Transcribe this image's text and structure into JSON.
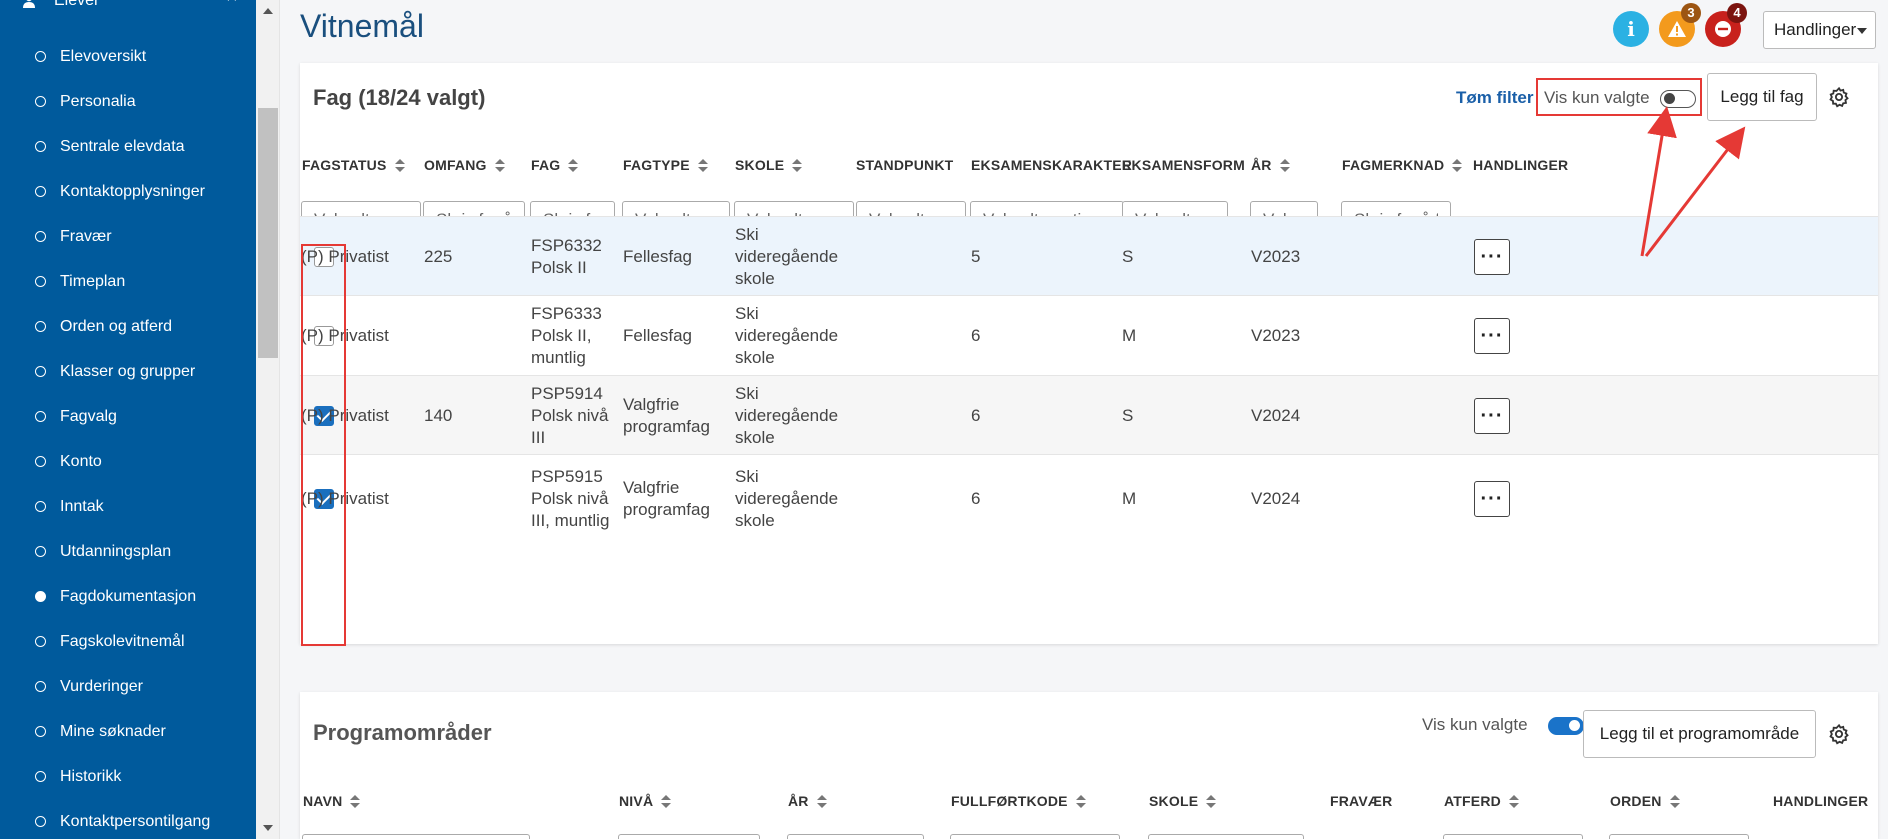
{
  "sidebar": {
    "section_label": "Elever",
    "items": [
      {
        "label": "Elevoversikt",
        "active": false
      },
      {
        "label": "Personalia",
        "active": false
      },
      {
        "label": "Sentrale elevdata",
        "active": false
      },
      {
        "label": "Kontaktopplysninger",
        "active": false
      },
      {
        "label": "Fravær",
        "active": false
      },
      {
        "label": "Timeplan",
        "active": false
      },
      {
        "label": "Orden og atferd",
        "active": false
      },
      {
        "label": "Klasser og grupper",
        "active": false
      },
      {
        "label": "Fagvalg",
        "active": false
      },
      {
        "label": "Konto",
        "active": false
      },
      {
        "label": "Inntak",
        "active": false
      },
      {
        "label": "Utdanningsplan",
        "active": false
      },
      {
        "label": "Fagdokumentasjon",
        "active": true
      },
      {
        "label": "Fagskolevitnemål",
        "active": false
      },
      {
        "label": "Vurderinger",
        "active": false
      },
      {
        "label": "Mine søknader",
        "active": false
      },
      {
        "label": "Historikk",
        "active": false
      },
      {
        "label": "Kontaktpersontilgang",
        "active": false
      }
    ]
  },
  "header": {
    "title": "Vitnemål",
    "info_icon_glyph": "i",
    "warning_count": "3",
    "error_count": "4",
    "actions_label": "Handlinger"
  },
  "fag": {
    "title": "Fag (18/24 valgt)",
    "clear_filter": "Tøm filter",
    "show_selected_label": "Vis kun valgte",
    "show_selected_on": false,
    "add_button": "Legg til fag",
    "columns": {
      "fagstatus": "FAGSTATUS",
      "omfang": "OMFANG",
      "fag": "FAG",
      "fagtype": "FAGTYPE",
      "skole": "SKOLE",
      "standpunkt": "STANDPUNKT",
      "eksamenskarakter": "EKSAMENSKARAKTER",
      "eksamensform": "EKSAMENSFORM",
      "ar": "ÅR",
      "fagmerknad": "FAGMERKNAD",
      "handlinger": "HANDLINGER"
    },
    "filters": {
      "fagstatus": "Velg alternativ",
      "omfang": "Skriv for å filtrere",
      "fag": "Skriv for å filtrere",
      "fagtype": "Velg alternativ",
      "skole": "Velg alternativ",
      "standpunkt": "Velg alternativ",
      "eksamenskarakter": "Velg alternativ",
      "eksamensform": "Velg alternativ",
      "ar": "Velg alternativ",
      "fagmerknad": "Skriv for å filtrere"
    },
    "rows": [
      {
        "checked": false,
        "fagstatus": "(P) Privatist",
        "omfang": "225",
        "fag": [
          "FSP6332",
          "Polsk II"
        ],
        "fagtype": [
          "Fellesfag"
        ],
        "skole": [
          "Ski",
          "videregående",
          "skole"
        ],
        "standpunkt": "",
        "eksamenskarakter": "5",
        "eksamensform": "S",
        "ar": "V2023",
        "fagmerknad": ""
      },
      {
        "checked": false,
        "fagstatus": "(P) Privatist",
        "omfang": "",
        "fag": [
          "FSP6333",
          "Polsk II,",
          "muntlig"
        ],
        "fagtype": [
          "Fellesfag"
        ],
        "skole": [
          "Ski",
          "videregående",
          "skole"
        ],
        "standpunkt": "",
        "eksamenskarakter": "6",
        "eksamensform": "M",
        "ar": "V2023",
        "fagmerknad": ""
      },
      {
        "checked": true,
        "fagstatus": "(P) Privatist",
        "omfang": "140",
        "fag": [
          "PSP5914",
          "Polsk nivå",
          "III"
        ],
        "fagtype": [
          "Valgfrie",
          "programfag"
        ],
        "skole": [
          "Ski",
          "videregående",
          "skole"
        ],
        "standpunkt": "",
        "eksamenskarakter": "6",
        "eksamensform": "S",
        "ar": "V2024",
        "fagmerknad": ""
      },
      {
        "checked": true,
        "fagstatus": "(P) Privatist",
        "omfang": "",
        "fag": [
          "PSP5915",
          "Polsk nivå",
          "III, muntlig"
        ],
        "fagtype": [
          "Valgfrie",
          "programfag"
        ],
        "skole": [
          "Ski",
          "videregående",
          "skole"
        ],
        "standpunkt": "",
        "eksamenskarakter": "6",
        "eksamensform": "M",
        "ar": "V2024",
        "fagmerknad": ""
      }
    ],
    "row_action_glyph": "···"
  },
  "programomrader": {
    "title": "Programområder",
    "show_selected_label": "Vis kun valgte",
    "show_selected_on": true,
    "add_button": "Legg til et programområde",
    "columns": {
      "navn": "NAVN",
      "niva": "NIVÅ",
      "ar": "ÅR",
      "fullfortkode": "FULLFØRTKODE",
      "skole": "SKOLE",
      "fravaer": "FRAVÆR",
      "atferd": "ATFERD",
      "orden": "ORDEN",
      "handlinger": "HANDLINGER"
    }
  },
  "colors": {
    "sidebar_bg": "#005a9c",
    "title": "#1a4f7e",
    "info": "#2bb1e3",
    "warning": "#f39a1d",
    "error": "#c8211c",
    "annotation": "#e53935",
    "checkbox": "#1a6fbe"
  }
}
